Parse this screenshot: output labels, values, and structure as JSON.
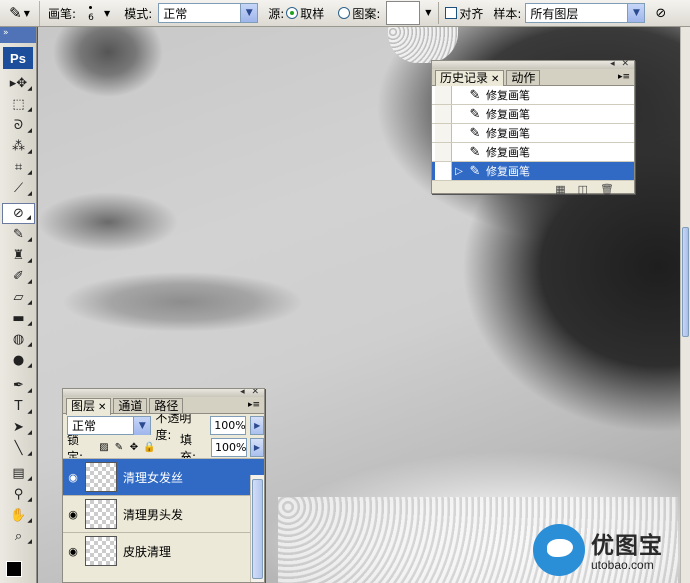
{
  "options_bar": {
    "brush_label": "画笔:",
    "brush_size": "6",
    "mode_label": "模式:",
    "mode_value": "正常",
    "source_label": "源:",
    "source_sampled": "取样",
    "source_pattern": "图案:",
    "aligned_label": "对齐",
    "sample_label": "样本:",
    "sample_value": "所有图层"
  },
  "toolbox": {
    "logo": "Ps",
    "tools": [
      {
        "icon": "move-icon",
        "glyph": "▸✥"
      },
      {
        "icon": "marquee-icon",
        "glyph": "⬚"
      },
      {
        "icon": "lasso-icon",
        "glyph": "ᘐ"
      },
      {
        "icon": "magic-wand-icon",
        "glyph": "⁂"
      },
      {
        "icon": "crop-icon",
        "glyph": "⌗"
      },
      {
        "icon": "slice-icon",
        "glyph": "⟋"
      },
      {
        "icon": "healing-brush-icon",
        "glyph": "⊘",
        "active": true
      },
      {
        "icon": "brush-icon",
        "glyph": "✎"
      },
      {
        "icon": "clone-stamp-icon",
        "glyph": "♜"
      },
      {
        "icon": "history-brush-icon",
        "glyph": "✐"
      },
      {
        "icon": "eraser-icon",
        "glyph": "▱"
      },
      {
        "icon": "gradient-icon",
        "glyph": "▬"
      },
      {
        "icon": "blur-icon",
        "glyph": "◍"
      },
      {
        "icon": "dodge-icon",
        "glyph": "●"
      },
      {
        "icon": "pen-icon",
        "glyph": "✒"
      },
      {
        "icon": "type-icon",
        "glyph": "T"
      },
      {
        "icon": "path-selection-icon",
        "glyph": "➤"
      },
      {
        "icon": "line-icon",
        "glyph": "╲"
      },
      {
        "icon": "notes-icon",
        "glyph": "▤"
      },
      {
        "icon": "eyedropper-icon",
        "glyph": "⚲"
      },
      {
        "icon": "hand-icon",
        "glyph": "✋"
      },
      {
        "icon": "zoom-icon",
        "glyph": "⌕"
      }
    ]
  },
  "history_panel": {
    "tabs": [
      "历史记录",
      "动作"
    ],
    "items": [
      {
        "label": "修复画笔",
        "selected": false
      },
      {
        "label": "修复画笔",
        "selected": false
      },
      {
        "label": "修复画笔",
        "selected": false
      },
      {
        "label": "修复画笔",
        "selected": false
      },
      {
        "label": "修复画笔",
        "selected": true
      }
    ]
  },
  "layers_panel": {
    "tabs": [
      "图层",
      "通道",
      "路径"
    ],
    "blend_mode": "正常",
    "opacity_label": "不透明度:",
    "opacity_value": "100%",
    "lock_label": "锁定:",
    "fill_label": "填充:",
    "fill_value": "100%",
    "layers": [
      {
        "name": "清理女发丝",
        "selected": true
      },
      {
        "name": "清理男头发",
        "selected": false
      },
      {
        "name": "皮肤清理",
        "selected": false
      }
    ]
  },
  "watermark": {
    "cn": "优图宝",
    "url": "utobao.com"
  },
  "colors": {
    "selection": "#316ac5",
    "panel_bg": "#ece9d8"
  }
}
